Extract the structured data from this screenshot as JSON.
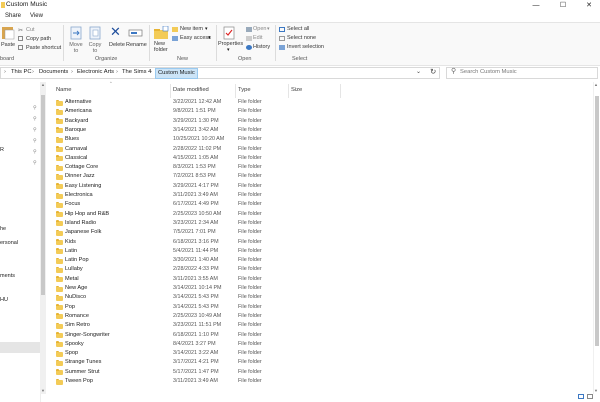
{
  "window": {
    "title": "Custom Music",
    "minimize": "—",
    "maximize": "☐",
    "close": "✕"
  },
  "tabs": [
    "Share",
    "View"
  ],
  "ribbon": {
    "clipboard": {
      "paste": "Paste",
      "cut": "Cut",
      "copy_path": "Copy path",
      "paste_shortcut": "Paste shortcut",
      "group": "board"
    },
    "organize": {
      "move_to": "Move to",
      "copy_to": "Copy to",
      "delete": "Delete",
      "rename": "Rename",
      "group": "Organize"
    },
    "new": {
      "new_folder": "New folder",
      "new_item": "New item",
      "easy_access": "Easy access",
      "group": "New"
    },
    "open": {
      "properties": "Properties",
      "open": "Open",
      "edit": "Edit",
      "history": "History",
      "group": "Open"
    },
    "select": {
      "select_all": "Select all",
      "select_none": "Select none",
      "invert_selection": "Invert selection",
      "group": "Select"
    }
  },
  "address": {
    "crumbs": [
      "This PC",
      "Documents",
      "Electronic Arts",
      "The Sims 4"
    ],
    "current": "Custom Music",
    "search_placeholder": "Search Custom Music"
  },
  "nav_fragments": [
    "R",
    "he",
    "ersonal",
    "ments",
    "HU"
  ],
  "columns": {
    "name": "Name",
    "date": "Date modified",
    "type": "Type",
    "size": "Size"
  },
  "files": [
    {
      "name": "Alternative",
      "date": "3/22/2021 12:42 AM",
      "type": "File folder"
    },
    {
      "name": "Americana",
      "date": "9/8/2021 1:51 PM",
      "type": "File folder"
    },
    {
      "name": "Backyard",
      "date": "3/29/2021 1:30 PM",
      "type": "File folder"
    },
    {
      "name": "Baroque",
      "date": "3/14/2021 3:42 AM",
      "type": "File folder"
    },
    {
      "name": "Blues",
      "date": "10/25/2021 10:20 AM",
      "type": "File folder"
    },
    {
      "name": "Carnaval",
      "date": "2/28/2022 11:02 PM",
      "type": "File folder"
    },
    {
      "name": "Classical",
      "date": "4/15/2021 1:05 AM",
      "type": "File folder"
    },
    {
      "name": "Cottage Core",
      "date": "8/3/2021 1:53 PM",
      "type": "File folder"
    },
    {
      "name": "Dinner Jazz",
      "date": "7/2/2021 8:53 PM",
      "type": "File folder"
    },
    {
      "name": "Easy Listening",
      "date": "3/29/2021 4:17 PM",
      "type": "File folder"
    },
    {
      "name": "Electronica",
      "date": "3/11/2021 3:49 AM",
      "type": "File folder"
    },
    {
      "name": "Focus",
      "date": "6/17/2021 4:49 PM",
      "type": "File folder"
    },
    {
      "name": "Hip Hop and R&B",
      "date": "2/25/2023 10:50 AM",
      "type": "File folder"
    },
    {
      "name": "Island Radio",
      "date": "3/23/2021 2:34 AM",
      "type": "File folder"
    },
    {
      "name": "Japanese Folk",
      "date": "7/5/2021 7:01 PM",
      "type": "File folder"
    },
    {
      "name": "Kids",
      "date": "6/18/2021 3:16 PM",
      "type": "File folder"
    },
    {
      "name": "Latin",
      "date": "5/4/2021 11:44 PM",
      "type": "File folder"
    },
    {
      "name": "Latin Pop",
      "date": "3/30/2021 1:40 AM",
      "type": "File folder"
    },
    {
      "name": "Lullaby",
      "date": "2/28/2022 4:33 PM",
      "type": "File folder"
    },
    {
      "name": "Metal",
      "date": "3/11/2021 3:55 AM",
      "type": "File folder"
    },
    {
      "name": "New Age",
      "date": "3/14/2021 10:14 PM",
      "type": "File folder"
    },
    {
      "name": "NuDisco",
      "date": "3/14/2021 5:43 PM",
      "type": "File folder"
    },
    {
      "name": "Pop",
      "date": "3/14/2021 5:43 PM",
      "type": "File folder"
    },
    {
      "name": "Romance",
      "date": "2/25/2023 10:49 AM",
      "type": "File folder"
    },
    {
      "name": "Sim Retro",
      "date": "3/23/2021 11:51 PM",
      "type": "File folder"
    },
    {
      "name": "Singer-Songwriter",
      "date": "6/18/2021 1:10 PM",
      "type": "File folder"
    },
    {
      "name": "Spooky",
      "date": "8/4/2021 3:27 PM",
      "type": "File folder"
    },
    {
      "name": "Spop",
      "date": "3/14/2021 3:22 AM",
      "type": "File folder"
    },
    {
      "name": "Strange Tunes",
      "date": "3/17/2021 4:21 PM",
      "type": "File folder"
    },
    {
      "name": "Summer Strut",
      "date": "5/17/2021 1:47 PM",
      "type": "File folder"
    },
    {
      "name": "Tween Pop",
      "date": "3/11/2021 3:49 AM",
      "type": "File folder"
    }
  ],
  "colors": {
    "folder": "#f3cb57",
    "selection": "#cce4f7",
    "ribbon_bg": "#f9f9f9"
  }
}
